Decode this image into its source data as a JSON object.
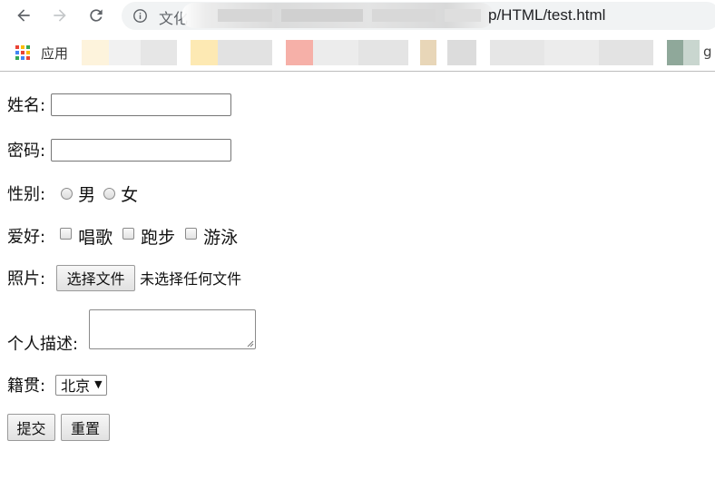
{
  "browser": {
    "url_prefix": "文化",
    "url_visible": "p/HTML/test.html",
    "bookmarks": {
      "apps_label": "应用",
      "tail_char": "g"
    }
  },
  "form": {
    "name_label": "姓名:",
    "password_label": "密码:",
    "gender": {
      "label": "性别:",
      "options": [
        "男",
        "女"
      ]
    },
    "hobbies": {
      "label": "爱好:",
      "options": [
        "唱歌",
        "跑步",
        "游泳"
      ]
    },
    "photo": {
      "label": "照片:",
      "button": "选择文件",
      "status": "未选择任何文件"
    },
    "description_label": "个人描述:",
    "hometown": {
      "label": "籍贯:",
      "selected": "北京"
    },
    "submit_button": "提交",
    "reset_button": "重置"
  },
  "colors": {
    "omnibox_bg": "#f1f3f4",
    "icon_gray": "#5f6368"
  }
}
